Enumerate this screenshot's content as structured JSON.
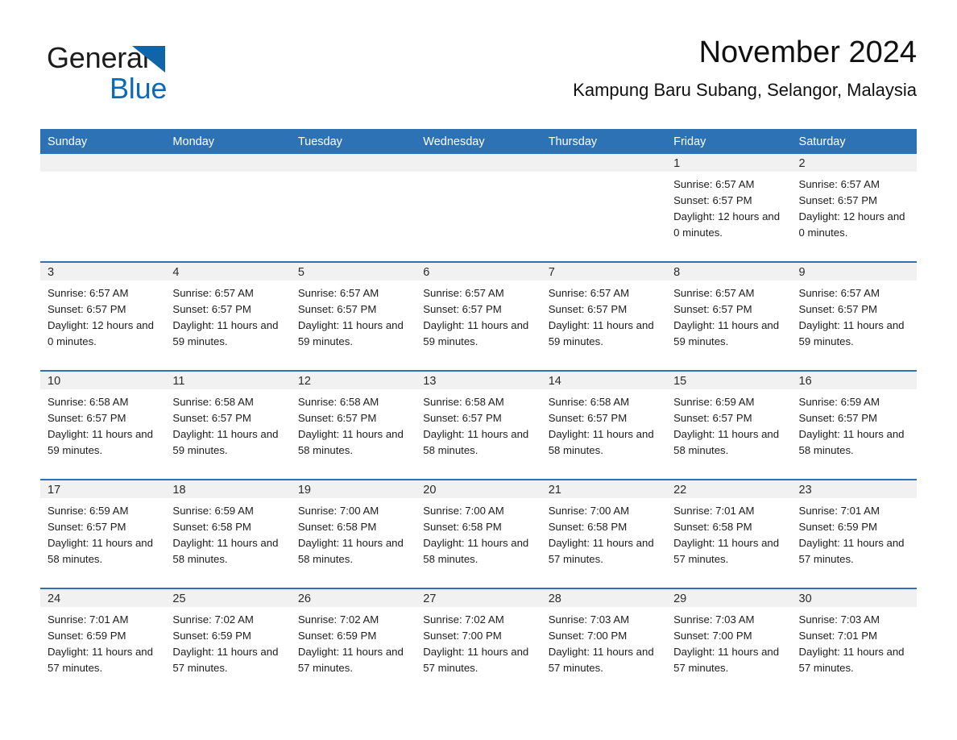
{
  "logo": {
    "word1": "General",
    "word2": "Blue",
    "triangle_color": "#1065a8",
    "blue_color": "#1069b4"
  },
  "header": {
    "title": "November 2024",
    "subtitle": "Kampung Baru Subang, Selangor, Malaysia"
  },
  "colors": {
    "header_blue": "#2c72b5",
    "row_separator": "#2c72b5",
    "daynum_band": "#f1f1f1",
    "text": "#1d1d1d"
  },
  "weekday_headers": [
    "Sunday",
    "Monday",
    "Tuesday",
    "Wednesday",
    "Thursday",
    "Friday",
    "Saturday"
  ],
  "weeks": [
    [
      {
        "day": "",
        "sunrise": "",
        "sunset": "",
        "daylight": ""
      },
      {
        "day": "",
        "sunrise": "",
        "sunset": "",
        "daylight": ""
      },
      {
        "day": "",
        "sunrise": "",
        "sunset": "",
        "daylight": ""
      },
      {
        "day": "",
        "sunrise": "",
        "sunset": "",
        "daylight": ""
      },
      {
        "day": "",
        "sunrise": "",
        "sunset": "",
        "daylight": ""
      },
      {
        "day": "1",
        "sunrise": "Sunrise: 6:57 AM",
        "sunset": "Sunset: 6:57 PM",
        "daylight": "Daylight: 12 hours and 0 minutes."
      },
      {
        "day": "2",
        "sunrise": "Sunrise: 6:57 AM",
        "sunset": "Sunset: 6:57 PM",
        "daylight": "Daylight: 12 hours and 0 minutes."
      }
    ],
    [
      {
        "day": "3",
        "sunrise": "Sunrise: 6:57 AM",
        "sunset": "Sunset: 6:57 PM",
        "daylight": "Daylight: 12 hours and 0 minutes."
      },
      {
        "day": "4",
        "sunrise": "Sunrise: 6:57 AM",
        "sunset": "Sunset: 6:57 PM",
        "daylight": "Daylight: 11 hours and 59 minutes."
      },
      {
        "day": "5",
        "sunrise": "Sunrise: 6:57 AM",
        "sunset": "Sunset: 6:57 PM",
        "daylight": "Daylight: 11 hours and 59 minutes."
      },
      {
        "day": "6",
        "sunrise": "Sunrise: 6:57 AM",
        "sunset": "Sunset: 6:57 PM",
        "daylight": "Daylight: 11 hours and 59 minutes."
      },
      {
        "day": "7",
        "sunrise": "Sunrise: 6:57 AM",
        "sunset": "Sunset: 6:57 PM",
        "daylight": "Daylight: 11 hours and 59 minutes."
      },
      {
        "day": "8",
        "sunrise": "Sunrise: 6:57 AM",
        "sunset": "Sunset: 6:57 PM",
        "daylight": "Daylight: 11 hours and 59 minutes."
      },
      {
        "day": "9",
        "sunrise": "Sunrise: 6:57 AM",
        "sunset": "Sunset: 6:57 PM",
        "daylight": "Daylight: 11 hours and 59 minutes."
      }
    ],
    [
      {
        "day": "10",
        "sunrise": "Sunrise: 6:58 AM",
        "sunset": "Sunset: 6:57 PM",
        "daylight": "Daylight: 11 hours and 59 minutes."
      },
      {
        "day": "11",
        "sunrise": "Sunrise: 6:58 AM",
        "sunset": "Sunset: 6:57 PM",
        "daylight": "Daylight: 11 hours and 59 minutes."
      },
      {
        "day": "12",
        "sunrise": "Sunrise: 6:58 AM",
        "sunset": "Sunset: 6:57 PM",
        "daylight": "Daylight: 11 hours and 58 minutes."
      },
      {
        "day": "13",
        "sunrise": "Sunrise: 6:58 AM",
        "sunset": "Sunset: 6:57 PM",
        "daylight": "Daylight: 11 hours and 58 minutes."
      },
      {
        "day": "14",
        "sunrise": "Sunrise: 6:58 AM",
        "sunset": "Sunset: 6:57 PM",
        "daylight": "Daylight: 11 hours and 58 minutes."
      },
      {
        "day": "15",
        "sunrise": "Sunrise: 6:59 AM",
        "sunset": "Sunset: 6:57 PM",
        "daylight": "Daylight: 11 hours and 58 minutes."
      },
      {
        "day": "16",
        "sunrise": "Sunrise: 6:59 AM",
        "sunset": "Sunset: 6:57 PM",
        "daylight": "Daylight: 11 hours and 58 minutes."
      }
    ],
    [
      {
        "day": "17",
        "sunrise": "Sunrise: 6:59 AM",
        "sunset": "Sunset: 6:57 PM",
        "daylight": "Daylight: 11 hours and 58 minutes."
      },
      {
        "day": "18",
        "sunrise": "Sunrise: 6:59 AM",
        "sunset": "Sunset: 6:58 PM",
        "daylight": "Daylight: 11 hours and 58 minutes."
      },
      {
        "day": "19",
        "sunrise": "Sunrise: 7:00 AM",
        "sunset": "Sunset: 6:58 PM",
        "daylight": "Daylight: 11 hours and 58 minutes."
      },
      {
        "day": "20",
        "sunrise": "Sunrise: 7:00 AM",
        "sunset": "Sunset: 6:58 PM",
        "daylight": "Daylight: 11 hours and 58 minutes."
      },
      {
        "day": "21",
        "sunrise": "Sunrise: 7:00 AM",
        "sunset": "Sunset: 6:58 PM",
        "daylight": "Daylight: 11 hours and 57 minutes."
      },
      {
        "day": "22",
        "sunrise": "Sunrise: 7:01 AM",
        "sunset": "Sunset: 6:58 PM",
        "daylight": "Daylight: 11 hours and 57 minutes."
      },
      {
        "day": "23",
        "sunrise": "Sunrise: 7:01 AM",
        "sunset": "Sunset: 6:59 PM",
        "daylight": "Daylight: 11 hours and 57 minutes."
      }
    ],
    [
      {
        "day": "24",
        "sunrise": "Sunrise: 7:01 AM",
        "sunset": "Sunset: 6:59 PM",
        "daylight": "Daylight: 11 hours and 57 minutes."
      },
      {
        "day": "25",
        "sunrise": "Sunrise: 7:02 AM",
        "sunset": "Sunset: 6:59 PM",
        "daylight": "Daylight: 11 hours and 57 minutes."
      },
      {
        "day": "26",
        "sunrise": "Sunrise: 7:02 AM",
        "sunset": "Sunset: 6:59 PM",
        "daylight": "Daylight: 11 hours and 57 minutes."
      },
      {
        "day": "27",
        "sunrise": "Sunrise: 7:02 AM",
        "sunset": "Sunset: 7:00 PM",
        "daylight": "Daylight: 11 hours and 57 minutes."
      },
      {
        "day": "28",
        "sunrise": "Sunrise: 7:03 AM",
        "sunset": "Sunset: 7:00 PM",
        "daylight": "Daylight: 11 hours and 57 minutes."
      },
      {
        "day": "29",
        "sunrise": "Sunrise: 7:03 AM",
        "sunset": "Sunset: 7:00 PM",
        "daylight": "Daylight: 11 hours and 57 minutes."
      },
      {
        "day": "30",
        "sunrise": "Sunrise: 7:03 AM",
        "sunset": "Sunset: 7:01 PM",
        "daylight": "Daylight: 11 hours and 57 minutes."
      }
    ]
  ]
}
